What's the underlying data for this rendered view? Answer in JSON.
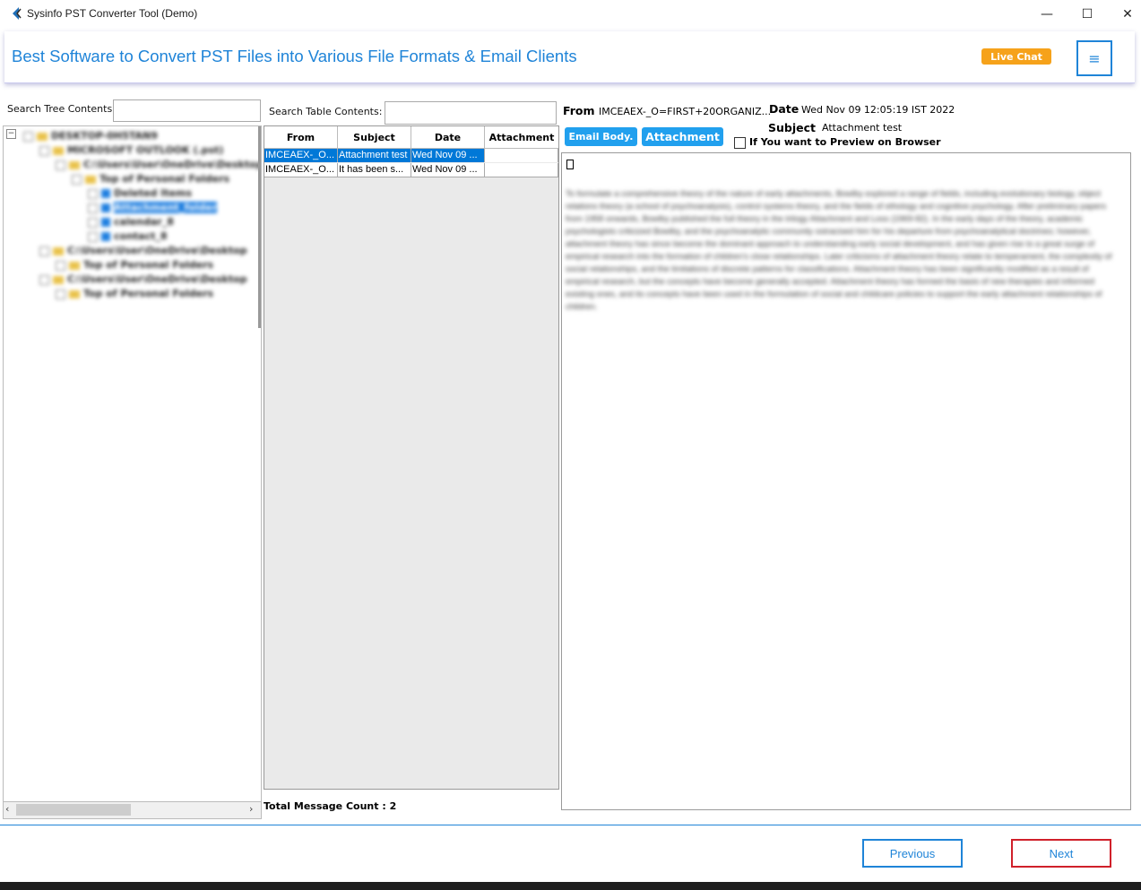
{
  "window": {
    "title": "Sysinfo PST Converter Tool (Demo)",
    "minimize": "—",
    "maximize": "☐",
    "close": "✕"
  },
  "banner": {
    "title": "Best Software to Convert PST Files into Various File Formats & Email Clients",
    "live_chat": "Live Chat",
    "menu_icon": "≡"
  },
  "tree": {
    "search_label": "Search Tree Contents:",
    "search_value": "",
    "nodes": [
      {
        "label": "DESKTOP-0H5TAN9",
        "level": 0
      },
      {
        "label": "MICROSOFT OUTLOOK (.pst)",
        "level": 1
      },
      {
        "label": "C:\\Users\\User\\OneDrive\\Desktop",
        "level": 2
      },
      {
        "label": "Top of Personal Folders",
        "level": 3
      },
      {
        "label": "Deleted Items",
        "level": 4
      },
      {
        "label": "Attachment_folder",
        "level": 4,
        "selected": true
      },
      {
        "label": "calendar_8",
        "level": 4
      },
      {
        "label": "contact_8",
        "level": 4
      },
      {
        "label": "C:\\Users\\User\\OneDrive\\Desktop",
        "level": 2
      },
      {
        "label": "Top of Personal Folders",
        "level": 3
      },
      {
        "label": "C:\\Users\\User\\OneDrive\\Desktop",
        "level": 2
      },
      {
        "label": "Top of Personal Folders",
        "level": 3
      }
    ]
  },
  "table": {
    "search_label": "Search Table Contents:",
    "search_value": "",
    "columns": [
      "From",
      "Subject",
      "Date",
      "Attachment"
    ],
    "rows": [
      {
        "from": "IMCEAEX-_O...",
        "subject": "Attachment test",
        "date": "Wed Nov 09 ...",
        "attachment": ""
      },
      {
        "from": "IMCEAEX-_O...",
        "subject": "It has been s...",
        "date": "Wed Nov 09 ...",
        "attachment": ""
      }
    ],
    "total_label": "Total Message Count : 2"
  },
  "email": {
    "from_label": "From",
    "from_value": "IMCEAEX-_O=FIRST+20ORGANIZ...",
    "date_label": "Date",
    "date_value": "Wed Nov 09 12:05:19 IST 2022",
    "subject_label": "Subject",
    "subject_value": "Attachment test",
    "tab_body": "Email Body.",
    "tab_attachment": "Attachment",
    "preview_label": "If You want to Preview on Browser",
    "body_glyph": "",
    "body_text": "To formulate a comprehensive theory of the nature of early attachments, Bowlby explored a range of fields, including evolutionary biology, object relations theory (a school of psychoanalysis), control systems theory, and the fields of ethology and cognitive psychology. After preliminary papers from 1958 onwards, Bowlby published the full theory in the trilogy Attachment and Loss (1969-82). In the early days of the theory, academic psychologists criticized Bowlby, and the psychoanalytic community ostracised him for his departure from psychoanalytical doctrines; however, attachment theory has since become the dominant approach to understanding early social development, and has given rise to a great surge of empirical research into the formation of children's close relationships. Later criticisms of attachment theory relate to temperament, the complexity of social relationships, and the limitations of discrete patterns for classifications. Attachment theory has been significantly modified as a result of empirical research, but the concepts have become generally accepted. Attachment theory has formed the basis of new therapies and informed existing ones, and its concepts have been used in the formulation of social and childcare policies to support the early attachment relationships of children."
  },
  "nav": {
    "previous": "Previous",
    "next": "Next"
  },
  "colors": {
    "accent": "#1f84d8",
    "live_chat": "#f6a21a",
    "selection": "#0078d7",
    "tab": "#21a0ee",
    "next_border": "#d0202a"
  }
}
